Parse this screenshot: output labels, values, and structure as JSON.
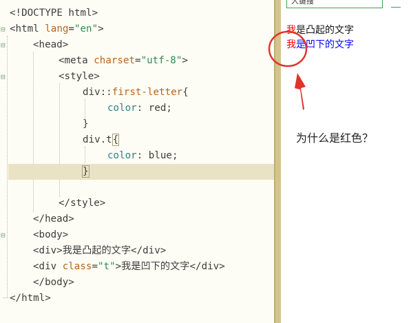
{
  "editor": {
    "lines": [
      {
        "parts": [
          {
            "t": "<!DOCTYPE html>",
            "c": "tag"
          }
        ]
      },
      {
        "parts": [
          {
            "t": "<html ",
            "c": "tag"
          },
          {
            "t": "lang",
            "c": "attr"
          },
          {
            "t": "=",
            "c": "tag"
          },
          {
            "t": "\"en\"",
            "c": "str"
          },
          {
            "t": ">",
            "c": "tag"
          }
        ]
      },
      {
        "parts": [
          {
            "t": "<head>",
            "c": "tag"
          }
        ]
      },
      {
        "parts": [
          {
            "t": "<meta ",
            "c": "tag"
          },
          {
            "t": "charset",
            "c": "attr"
          },
          {
            "t": "=",
            "c": "tag"
          },
          {
            "t": "\"utf-8\"",
            "c": "str"
          },
          {
            "t": ">",
            "c": "tag"
          }
        ]
      },
      {
        "parts": [
          {
            "t": "<style>",
            "c": "tag"
          }
        ]
      },
      {
        "parts": [
          {
            "t": "div::",
            "c": "kw"
          },
          {
            "t": "first-letter",
            "c": "pseudo"
          },
          {
            "t": "{",
            "c": "kw"
          }
        ]
      },
      {
        "parts": [
          {
            "t": "color",
            "c": "prop"
          },
          {
            "t": ": red;",
            "c": "kw"
          }
        ]
      },
      {
        "parts": [
          {
            "t": "}",
            "c": "kw"
          }
        ]
      },
      {
        "parts": [
          {
            "t": "div.t",
            "c": "kw"
          },
          {
            "t": "{",
            "c": "kw"
          }
        ]
      },
      {
        "parts": [
          {
            "t": "color",
            "c": "prop"
          },
          {
            "t": ": blue;",
            "c": "kw"
          }
        ]
      },
      {
        "parts": [
          {
            "t": "}",
            "c": "kw"
          }
        ]
      },
      {
        "parts": []
      },
      {
        "parts": [
          {
            "t": "</style>",
            "c": "tag"
          }
        ]
      },
      {
        "parts": [
          {
            "t": "</head>",
            "c": "tag"
          }
        ]
      },
      {
        "parts": [
          {
            "t": "<body>",
            "c": "tag"
          }
        ]
      },
      {
        "parts": [
          {
            "t": "<div>",
            "c": "tag"
          },
          {
            "t": "我是凸起的文字",
            "c": "kw"
          },
          {
            "t": "</div>",
            "c": "tag"
          }
        ]
      },
      {
        "parts": [
          {
            "t": "<div ",
            "c": "tag"
          },
          {
            "t": "class",
            "c": "attr"
          },
          {
            "t": "=",
            "c": "tag"
          },
          {
            "t": "\"t\"",
            "c": "str"
          },
          {
            "t": ">",
            "c": "tag"
          },
          {
            "t": "我是凹下的文字",
            "c": "kw"
          },
          {
            "t": "</div>",
            "c": "tag"
          }
        ]
      },
      {
        "parts": [
          {
            "t": "</body>",
            "c": "tag"
          }
        ]
      },
      {
        "parts": [
          {
            "t": "</html>",
            "c": "tag"
          }
        ]
      }
    ]
  },
  "preview": {
    "address_text": "人键搜",
    "line1_first": "我",
    "line1_rest": "是凸起的文字",
    "line2_first": "我",
    "line2_rest": "是凹下的文字"
  },
  "annotation": {
    "question": "为什么是红色？",
    "annotation_color": "#e0332a"
  },
  "colors": {
    "editor_bg": "#fdfdf5",
    "highlight_line": "#e9e2c4",
    "divider": "#d5c48a",
    "red_text": "#ff0000",
    "blue_text": "#0000ff"
  }
}
